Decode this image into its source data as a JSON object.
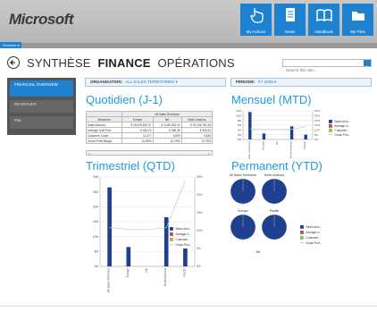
{
  "header": {
    "logo": "Microsoft",
    "tiles": [
      {
        "label": "My Actions",
        "icon": "hand-pointer-icon"
      },
      {
        "label": "News",
        "icon": "document-icon"
      },
      {
        "label": "Handbook",
        "icon": "open-book-icon"
      },
      {
        "label": "My Files",
        "icon": "folder-icon"
      }
    ],
    "strip_button": "Services ▾"
  },
  "nav": {
    "tabs": [
      "SYNTHÈSE",
      "FINANCE",
      "OPÉRATIONS"
    ],
    "active": "FINANCE"
  },
  "search": {
    "placeholder": "Search this site..."
  },
  "sidebar": {
    "items": [
      {
        "label": "FINANCIAL OVERVIEW",
        "selected": true
      },
      {
        "label": "REVENUES",
        "selected": false
      },
      {
        "label": "P&L",
        "selected": false
      }
    ]
  },
  "filters": {
    "organisation_label": "ORGANISATION:",
    "organisation_value": "ALL SALES TERRITORIES ▾",
    "periode_label": "PÉRIODE:",
    "periode_value": "FY 2008 ▾"
  },
  "sections": {
    "daily": "Quotidien (J-1)",
    "monthly": "Mensuel (MTD)",
    "quarterly": "Trimestriel (QTD)",
    "yearly": "Permanent (YTD)"
  },
  "table": {
    "group_header": "All Sales Territories",
    "columns": [
      "Measures",
      "Europe",
      "NA",
      "North America"
    ],
    "rows": [
      [
        "Sales Amount",
        "€ 16,679,820.07",
        "€ 3,045,932.24",
        "€ 16,226,782.25"
      ],
      [
        "Average Unit Price",
        "€ 346.22",
        "€ 356.35",
        "€ 326.82"
      ],
      [
        "Customer Count",
        "11,377",
        "3,699",
        "9,826"
      ],
      [
        "Gross Profit Margin",
        "10.89%",
        "10.29%",
        "10.79%"
      ]
    ],
    "scroll_left": "<",
    "scroll_right": ">"
  },
  "legend": [
    "Sales Amo...",
    "Average U...",
    "Customer...",
    "Gross Prof..."
  ],
  "chart_data": [
    {
      "type": "bar",
      "title": "Mensuel (MTD)",
      "left_axis": {
        "ticks": [
          "0M",
          "2M",
          "4M",
          "6M",
          "8M",
          "10M",
          "12M"
        ],
        "ylim": [
          0,
          12
        ]
      },
      "right_axis": {
        "ticks": [
          "0%",
          "5%",
          "10%",
          "15%",
          "20%",
          "25%",
          "30%"
        ]
      },
      "categories": [
        "All Sales Territories",
        "Europe",
        "NA",
        "North America",
        "Pacific"
      ],
      "series": [
        {
          "name": "Sales Amo...",
          "values": [
            11.5,
            2.5,
            0.0,
            5.5,
            2.0
          ],
          "color": "#1f3f8f"
        }
      ],
      "line": {
        "name": "Gross Prof...",
        "values": [
          10.9,
          10.3,
          10.3,
          10.8,
          13.5
        ]
      }
    },
    {
      "type": "bar",
      "title": "Trimestriel (QTD)",
      "left_axis": {
        "ticks": [
          "0M",
          "5M",
          "10M",
          "15M",
          "20M",
          "25M",
          "30M"
        ],
        "ylim": [
          0,
          30
        ]
      },
      "right_axis": {
        "ticks": [
          "0%",
          "5%",
          "10%",
          "15%",
          "20%",
          "25%"
        ]
      },
      "categories": [
        "All Sales Territories",
        "Europe",
        "NA",
        "North America",
        "Pacific"
      ],
      "series": [
        {
          "name": "Sales Amo...",
          "values": [
            26.5,
            6.5,
            0.0,
            16.5,
            6.0
          ],
          "color": "#1f3f8f"
        }
      ],
      "line": {
        "name": "Gross Prof...",
        "values": [
          10.9,
          10.3,
          10.3,
          10.8,
          24.0
        ]
      }
    },
    {
      "type": "pie",
      "title": "Permanent (YTD)",
      "pies": [
        "All Sales Territories",
        "North America",
        "Europe",
        "Pacific",
        "NA"
      ],
      "legend": [
        "Sales Amo...",
        "Average U...",
        "Customer...",
        "Gross Prof..."
      ]
    }
  ]
}
